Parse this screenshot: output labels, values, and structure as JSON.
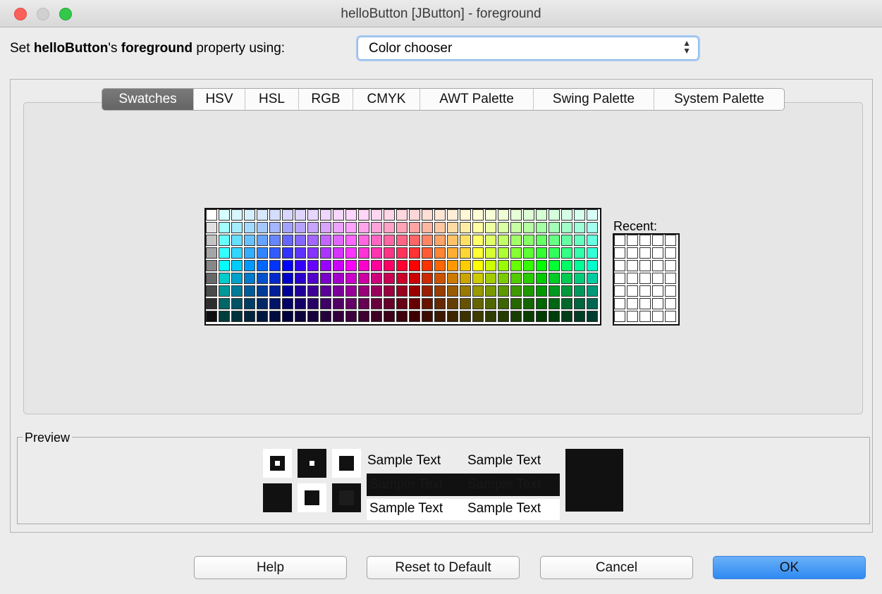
{
  "window": {
    "title": "helloButton [JButton] - foreground"
  },
  "property_line": {
    "prefix": "Set ",
    "component": "helloButton",
    "possessive": "'s ",
    "property": "foreground",
    "suffix": " property using:"
  },
  "editor_select": {
    "value": "Color chooser"
  },
  "tabs": [
    {
      "label": "Swatches",
      "active": true
    },
    {
      "label": "HSV",
      "active": false
    },
    {
      "label": "HSL",
      "active": false
    },
    {
      "label": "RGB",
      "active": false
    },
    {
      "label": "CMYK",
      "active": false
    },
    {
      "label": "AWT Palette",
      "active": false
    },
    {
      "label": "Swing Palette",
      "active": false
    },
    {
      "label": "System Palette",
      "active": false
    }
  ],
  "swatches": {
    "recent_label": "Recent:"
  },
  "preview": {
    "legend": "Preview",
    "sample_text": "Sample Text",
    "foreground_color": "#111111"
  },
  "buttons": {
    "help": "Help",
    "reset": "Reset to Default",
    "cancel": "Cancel",
    "ok": "OK"
  }
}
